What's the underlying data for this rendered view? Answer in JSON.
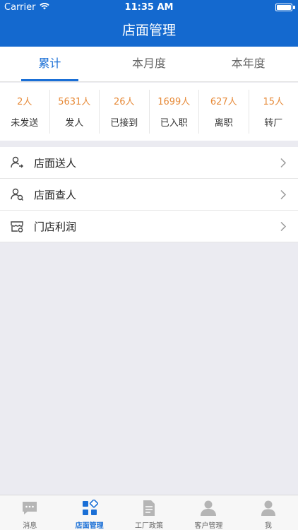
{
  "status_bar": {
    "carrier": "Carrier",
    "time": "11:35 AM"
  },
  "header": {
    "title": "店面管理"
  },
  "tabs": [
    {
      "label": "累计",
      "active": true
    },
    {
      "label": "本月度",
      "active": false
    },
    {
      "label": "本年度",
      "active": false
    }
  ],
  "stats": [
    {
      "value": "2人",
      "label": "未发送"
    },
    {
      "value": "5631人",
      "label": "发人"
    },
    {
      "value": "26人",
      "label": "已接到"
    },
    {
      "value": "1699人",
      "label": "已入职"
    },
    {
      "value": "627人",
      "label": "离职"
    },
    {
      "value": "15人",
      "label": "转厂"
    }
  ],
  "menu": [
    {
      "label": "店面送人",
      "icon": "user-send-icon"
    },
    {
      "label": "店面查人",
      "icon": "user-search-icon"
    },
    {
      "label": "门店利润",
      "icon": "store-icon"
    }
  ],
  "tabbar": [
    {
      "label": "消息",
      "icon": "message-icon",
      "active": false
    },
    {
      "label": "店面管理",
      "icon": "grid-icon",
      "active": true
    },
    {
      "label": "工厂政策",
      "icon": "document-icon",
      "active": false
    },
    {
      "label": "客户管理",
      "icon": "customers-icon",
      "active": false
    },
    {
      "label": "我",
      "icon": "profile-icon",
      "active": false
    }
  ],
  "colors": {
    "primary": "#1469cf",
    "accent": "#1a6fd6",
    "stat_value": "#e78b3a"
  }
}
